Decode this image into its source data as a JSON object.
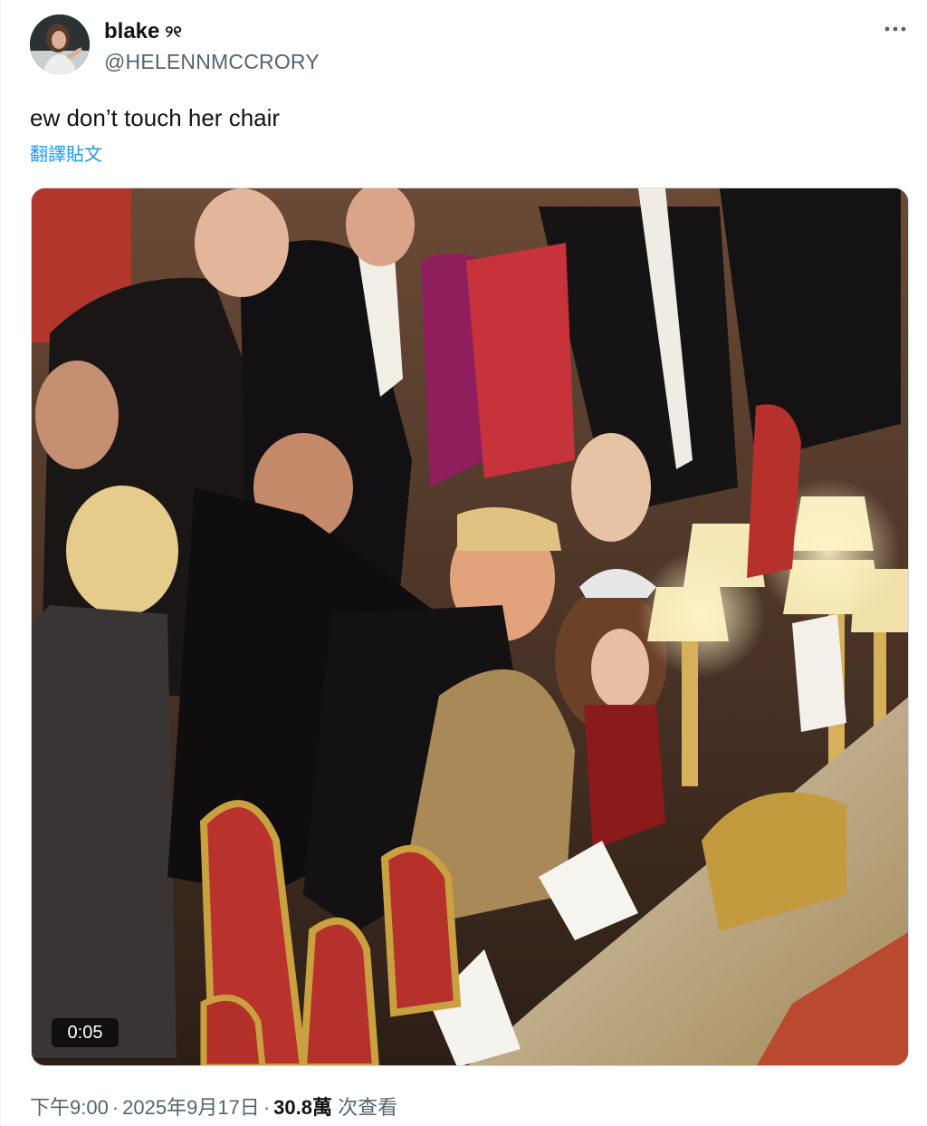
{
  "user": {
    "display_name": "blake",
    "display_emoji": "୨୧",
    "handle": "@HELENNMCCRORY"
  },
  "tweet": {
    "text": "ew don’t touch her chair",
    "translate_label": "翻譯貼文"
  },
  "media": {
    "video_time": "0:05"
  },
  "footer": {
    "time": "下午9:00",
    "separator": "·",
    "date": "2025年9月17日",
    "views_count": "30.8萬",
    "views_label": "次查看"
  },
  "icons": {
    "more": "more-horizontal-icon"
  },
  "colors": {
    "link": "#1d9bf0",
    "secondary_text": "#536471",
    "primary_text": "#0f1419"
  }
}
